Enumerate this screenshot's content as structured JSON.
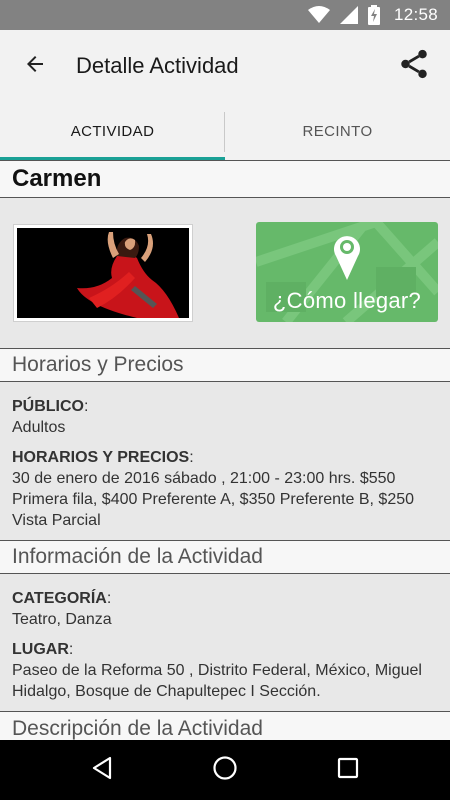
{
  "status_bar": {
    "time": "12:58",
    "icons": [
      "wifi-icon",
      "cell-signal-icon",
      "battery-charging-icon"
    ]
  },
  "app_bar": {
    "title": "Detalle Actividad",
    "back_icon": "arrow-back-icon",
    "share_icon": "share-icon"
  },
  "tabs": [
    {
      "label": "ACTIVIDAD",
      "active": true
    },
    {
      "label": "RECINTO",
      "active": false
    }
  ],
  "activity": {
    "name": "Carmen",
    "map_button_label": "¿Cómo llegar?"
  },
  "sections": {
    "schedule": {
      "title": "Horarios y Precios",
      "public_label": "PÚBLICO",
      "public_value": "Adultos",
      "hours_label": "HORARIOS Y PRECIOS",
      "hours_value": "30 de enero de 2016 sábado , 21:00 - 23:00 hrs. $550 Primera fila, $400 Preferente A, $350 Preferente B, $250 Vista Parcial"
    },
    "info": {
      "title": "Información de la Actividad",
      "category_label": "CATEGORÍA",
      "category_value": "Teatro, Danza",
      "place_label": "LUGAR",
      "place_value": "Paseo de la Reforma 50 , Distrito Federal, México, Miguel Hidalgo, Bosque de Chapultepec I Sección."
    },
    "description": {
      "title": "Descripción de la Actividad"
    }
  },
  "colors": {
    "accent": "#1aa196",
    "map_button": "#66b96a",
    "status_bar": "#828282",
    "app_bar": "#f2f2f2",
    "background": "#e8e8e8"
  },
  "nav_bar": {
    "icons": [
      "nav-back-icon",
      "nav-home-icon",
      "nav-recents-icon"
    ]
  }
}
